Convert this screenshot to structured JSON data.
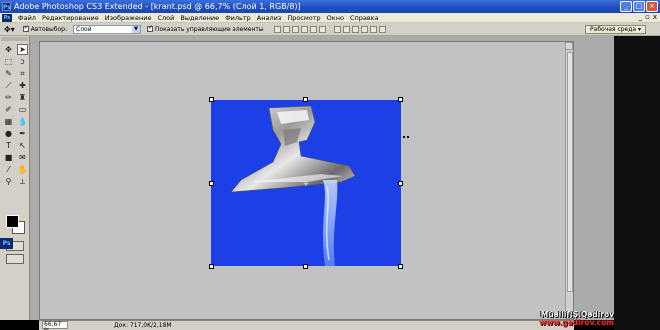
{
  "window": {
    "title": "Adobe Photoshop CS3 Extended - [krant.psd @ 66,7% (Слой 1, RGB/8)]",
    "icon_label": "Ps",
    "buttons": [
      "minimize",
      "maximize",
      "close"
    ]
  },
  "menu": {
    "logo": "Ps",
    "items": [
      "Файл",
      "Редактирование",
      "Изображение",
      "Слой",
      "Выделение",
      "Фильтр",
      "Анализ",
      "Просмотр",
      "Окно",
      "Справка"
    ],
    "doc_controls": [
      "_",
      "▫",
      "x"
    ]
  },
  "options": {
    "auto_select_label": "Автовыбор:",
    "auto_select_checked": true,
    "auto_select_value": "Слой",
    "show_controls_label": "Показать управляющие элементы",
    "show_controls_checked": true,
    "workspace_label": "Рабочая среда ▾"
  },
  "tools": {
    "label": "Ps",
    "foreground_color": "#000000",
    "background_color": "#ffffff"
  },
  "document": {
    "canvas_color": "#1c3fe6",
    "subject": "faucet with running water"
  },
  "status": {
    "zoom": "66,67 %",
    "doc_size": "Док: 717,0K/2,18M"
  },
  "watermark": {
    "line1": "Müəllif:Ş.Qədirov",
    "line2": "www.gadirov.com"
  }
}
